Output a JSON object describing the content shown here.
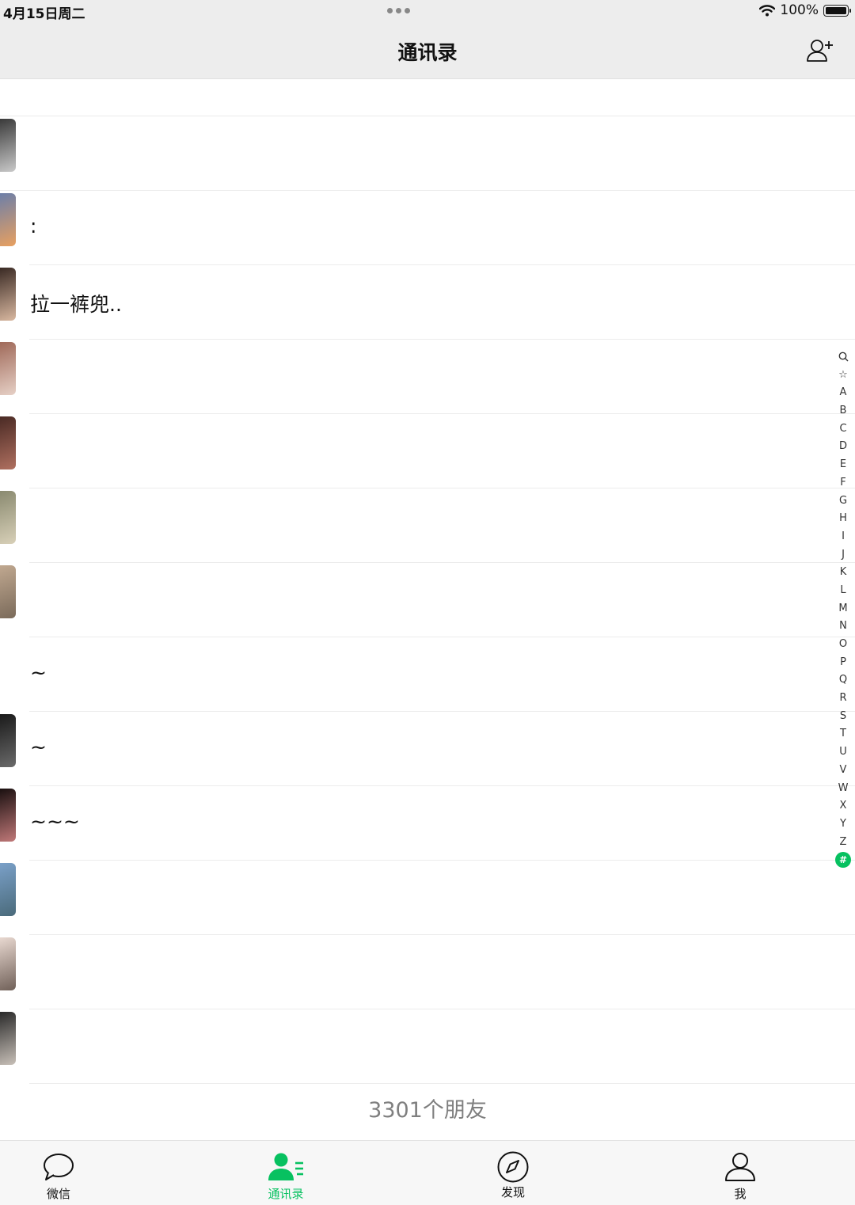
{
  "status_bar": {
    "time": "4月15日周二",
    "battery": "100%"
  },
  "nav": {
    "title": "通讯录",
    "add_icon": "add-contact-icon"
  },
  "contacts": [
    {
      "name": "",
      "avatar_colors": [
        "#3a3a3a",
        "#c9c9c9"
      ]
    },
    {
      "name": ":",
      "avatar_colors": [
        "#6d7fa8",
        "#e8a060"
      ]
    },
    {
      "name": "拉一裤兜..",
      "avatar_colors": [
        "#3a2a24",
        "#d9b8a0"
      ]
    },
    {
      "name": "",
      "avatar_colors": [
        "#a06a5a",
        "#e6d0c6"
      ]
    },
    {
      "name": "",
      "avatar_colors": [
        "#4a2a24",
        "#b07060"
      ]
    },
    {
      "name": "",
      "avatar_colors": [
        "#8a8a70",
        "#d8d0b8"
      ]
    },
    {
      "name": "",
      "avatar_colors": [
        "#c0a890",
        "#7a6a5a"
      ]
    },
    {
      "name": "~",
      "avatar_colors": [
        "#ffffff",
        "#ffffff"
      ]
    },
    {
      "name": "~",
      "avatar_colors": [
        "#1a1a1a",
        "#6a6a6a"
      ]
    },
    {
      "name": "~~~",
      "avatar_colors": [
        "#1a1010",
        "#c07878"
      ]
    },
    {
      "name": "",
      "avatar_colors": [
        "#7aa0c8",
        "#4a6a7a"
      ]
    },
    {
      "name": "",
      "avatar_colors": [
        "#e8d8d0",
        "#706058"
      ]
    },
    {
      "name": "",
      "avatar_colors": [
        "#2a2a2a",
        "#c8c0b8"
      ]
    }
  ],
  "index_letters": [
    "Q",
    "☆",
    "A",
    "B",
    "C",
    "D",
    "E",
    "F",
    "G",
    "H",
    "I",
    "J",
    "K",
    "L",
    "M",
    "N",
    "O",
    "P",
    "Q",
    "R",
    "S",
    "T",
    "U",
    "V",
    "W",
    "X",
    "Y",
    "Z",
    "#"
  ],
  "index_active": "#",
  "friend_count": "3301个朋友",
  "tabs": [
    {
      "label": "微信",
      "icon": "chat-bubble-icon",
      "active": false
    },
    {
      "label": "通讯录",
      "icon": "contacts-icon",
      "active": true
    },
    {
      "label": "发现",
      "icon": "compass-icon",
      "active": false
    },
    {
      "label": "我",
      "icon": "person-icon",
      "active": false
    }
  ],
  "accent_color": "#07c160"
}
